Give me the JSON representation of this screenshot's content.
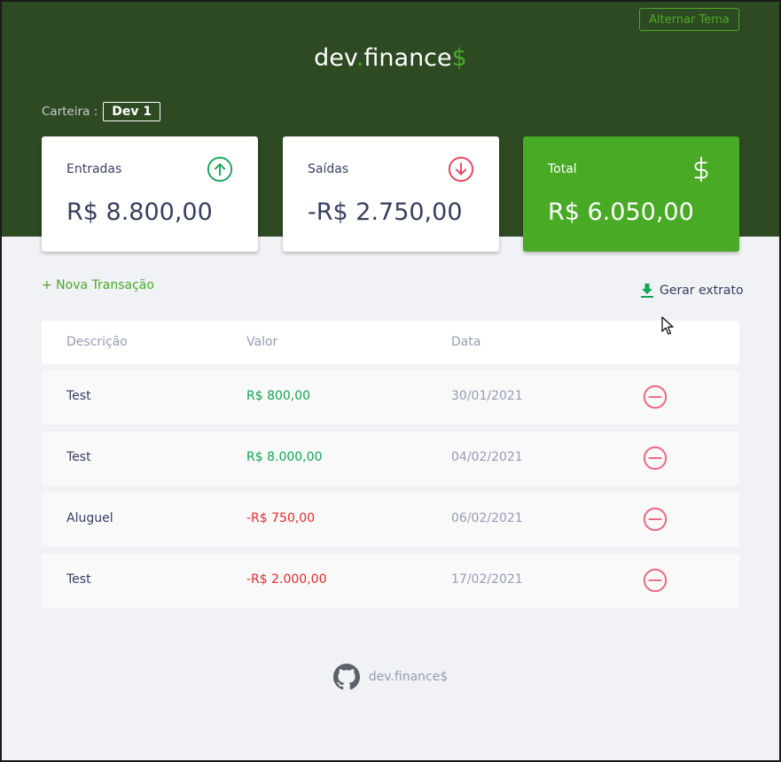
{
  "header": {
    "theme_button": "Alternar Tema",
    "logo": {
      "part1": "dev",
      "dot": ".",
      "part2": "finance",
      "dollar": "$"
    },
    "wallet_label": "Carteira :",
    "wallet_name": "Dev 1"
  },
  "cards": {
    "income": {
      "label": "Entradas",
      "value": "R$ 8.800,00",
      "icon": "arrow-up-circle-icon"
    },
    "expense": {
      "label": "Saídas",
      "value": "-R$ 2.750,00",
      "icon": "arrow-down-circle-icon"
    },
    "total": {
      "label": "Total",
      "value": "R$ 6.050,00",
      "icon": "dollar-icon"
    }
  },
  "actions": {
    "new_transaction": "+ Nova Transação",
    "generate_report": "Gerar extrato"
  },
  "table": {
    "columns": [
      "Descrição",
      "Valor",
      "Data"
    ],
    "rows": [
      {
        "description": "Test",
        "amount": "R$ 800,00",
        "date": "30/01/2021",
        "type": "income"
      },
      {
        "description": "Test",
        "amount": "R$ 8.000,00",
        "date": "04/02/2021",
        "type": "income"
      },
      {
        "description": "Aluguel",
        "amount": "-R$ 750,00",
        "date": "06/02/2021",
        "type": "expense"
      },
      {
        "description": "Test",
        "amount": "-R$ 2.000,00",
        "date": "17/02/2021",
        "type": "expense"
      }
    ]
  },
  "footer": {
    "text": "dev.finance$"
  },
  "colors": {
    "header_bg": "#2d4a22",
    "accent": "#49aa26",
    "income": "#12a454",
    "expense": "#e92929",
    "text": "#363f5f",
    "muted": "#969cb3"
  }
}
